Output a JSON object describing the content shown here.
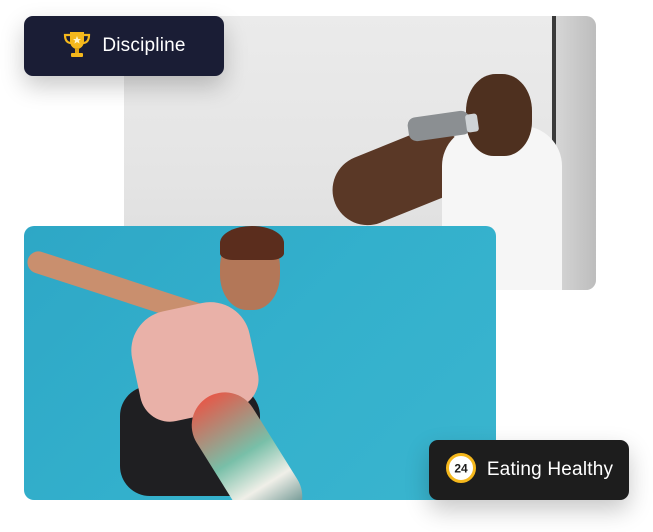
{
  "colors": {
    "discipline_badge_bg": "#1a1d35",
    "eating_badge_bg": "#1d1d1d",
    "sky": "#33b0cc",
    "trophy": "#f5b81c"
  },
  "badges": {
    "discipline": {
      "label": "Discipline",
      "icon": "trophy-icon"
    },
    "eating": {
      "label": "Eating Healthy",
      "icon": "clock-24-icon",
      "icon_text": "24"
    }
  }
}
